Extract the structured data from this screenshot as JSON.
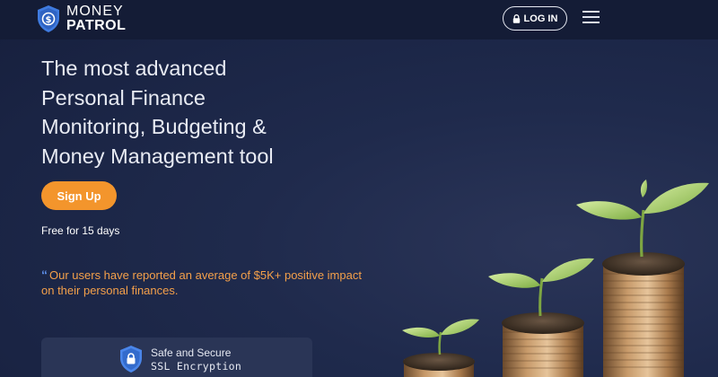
{
  "header": {
    "logo_line1": "MONEY",
    "logo_line2": "PATROL",
    "login_label": "LOG IN"
  },
  "hero": {
    "headline_lines": [
      "The most advanced",
      "Personal Finance",
      "Monitoring, Budgeting &",
      "Money Management tool"
    ],
    "signup_label": "Sign Up",
    "trial_text": "Free for 15 days",
    "quote_text": "Our users have reported an average of $5K+ positive impact on their personal finances."
  },
  "secure_card": {
    "line1": "Safe and Secure",
    "line2": "SSL Encryption"
  },
  "colors": {
    "background": "#1c2747",
    "header": "#141c36",
    "accent_orange": "#f3952c",
    "quote_orange": "#f4a04a",
    "shield_blue": "#3f7be0"
  },
  "icons": [
    "dollar-shield-icon",
    "lock-icon",
    "hamburger-menu-icon",
    "quote-icon",
    "lock-shield-icon"
  ]
}
